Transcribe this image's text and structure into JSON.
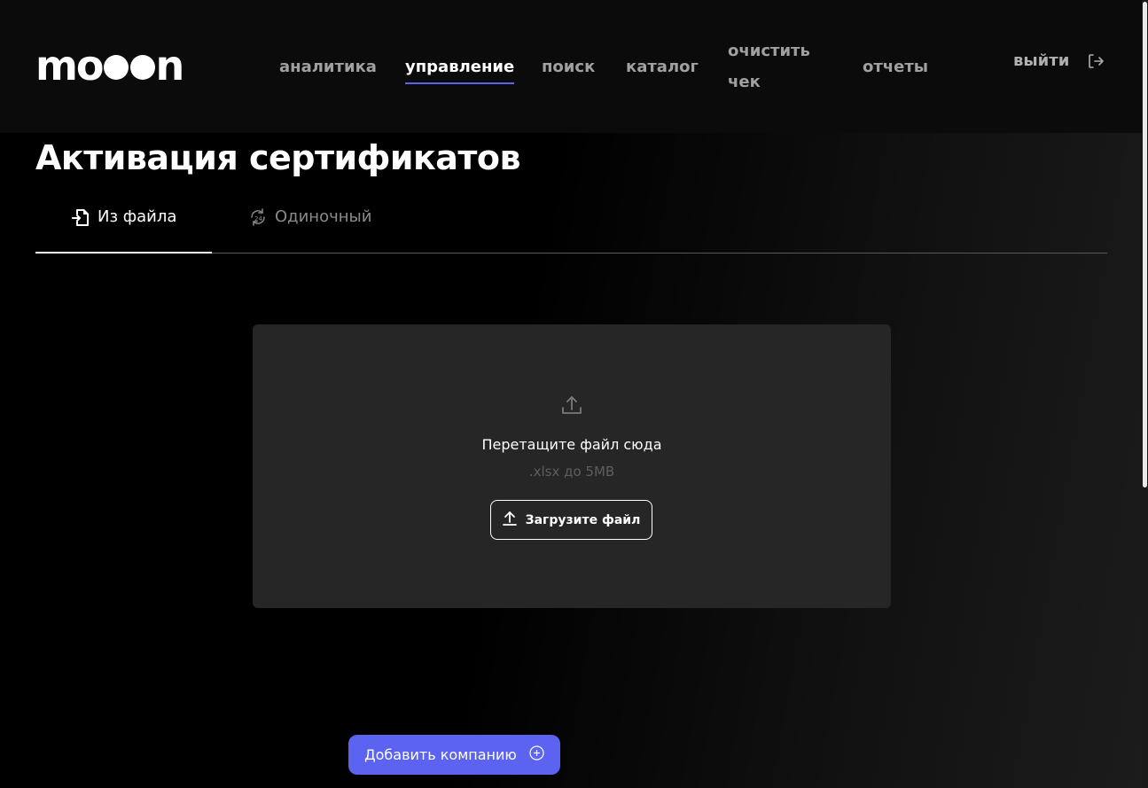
{
  "header": {
    "logo_text_start": "mo",
    "logo_text_end": "n",
    "nav": [
      {
        "label": "аналитика",
        "active": false
      },
      {
        "label": "управление",
        "active": true
      },
      {
        "label": "поиск",
        "active": false
      },
      {
        "label": "каталог",
        "active": false
      },
      {
        "label": "очистить чек",
        "active": false
      },
      {
        "label": "отчеты",
        "active": false
      }
    ],
    "logout_label": "выйти"
  },
  "page": {
    "title": "Активация сертификатов"
  },
  "tabs": [
    {
      "label": "Из файла",
      "active": true,
      "icon": "file-import-icon"
    },
    {
      "label": "Одиночный",
      "active": false,
      "icon": "refresh-24-icon"
    }
  ],
  "dropzone": {
    "text": "Перетащите файл сюда",
    "hint": ".xlsx до 5MB",
    "button_label": "Загрузите файл"
  },
  "actions": {
    "add_company_label": "Добавить компанию"
  },
  "colors": {
    "accent": "#5b63f0",
    "dropzone_bg": "#262626",
    "header_bg": "#0b0b0b"
  }
}
